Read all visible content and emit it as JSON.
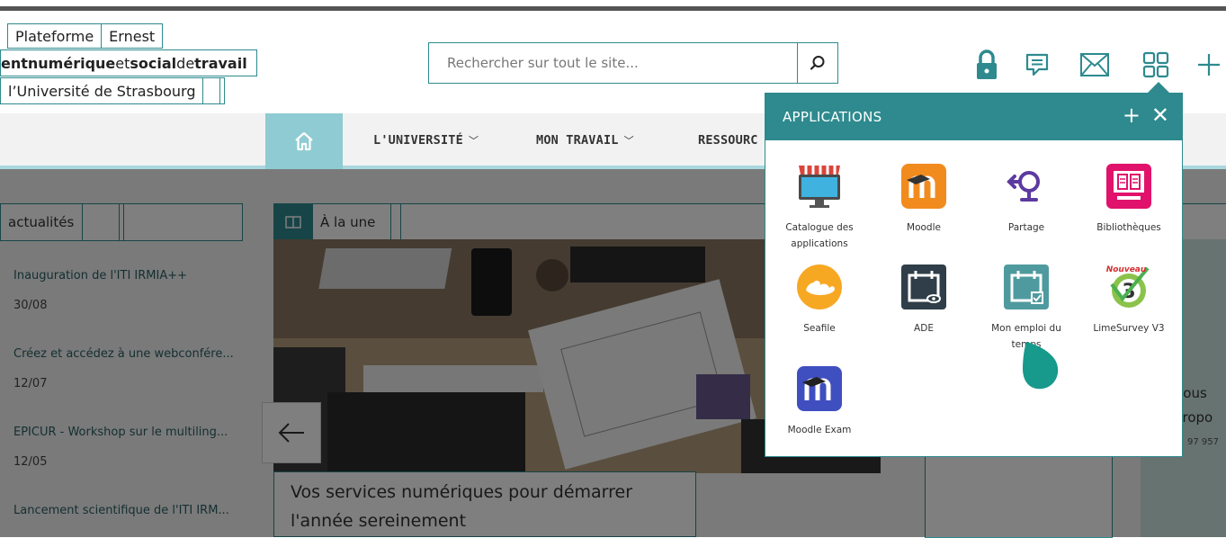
{
  "brand": {
    "platform": "Plateforme",
    "name": "Ernest",
    "tagline_pre": "ent ",
    "tagline_bold1": "numérique",
    "tagline_mid": " et ",
    "tagline_bold2": "social",
    "tagline_mid2": " de ",
    "tagline_bold3": "travail",
    "university": "l’Université de Strasbourg"
  },
  "search": {
    "placeholder": "Rechercher sur tout le site..."
  },
  "header_icons": [
    "lock-icon",
    "chat-icon",
    "mail-icon",
    "apps-grid-icon",
    "plus-icon"
  ],
  "nav": {
    "items": [
      {
        "label": "L'UNIVERSITÉ"
      },
      {
        "label": "MON TRAVAIL"
      },
      {
        "label": "RESSOURC"
      }
    ]
  },
  "news": {
    "header": "actualités",
    "items": [
      {
        "title": "Inauguration de l'ITI IRMIA++",
        "date": "30/08"
      },
      {
        "title": "Créez et accédez à une webconfére...",
        "date": "12/07"
      },
      {
        "title": "EPICUR - Workshop sur le multiling...",
        "date": "12/05"
      },
      {
        "title": "Lancement scientifique de l'ITI IRM...",
        "date": ""
      }
    ]
  },
  "featured": {
    "header": "À la une",
    "caption": "Vos services numériques pour démarrer l'année sereinement"
  },
  "apps_panel": {
    "title": "APPLICATIONS",
    "add_symbol": "+",
    "close_symbol": "✕",
    "items": [
      {
        "label": "Catalogue des applications",
        "icon": "catalogue-icon"
      },
      {
        "label": "Moodle",
        "icon": "moodle-icon"
      },
      {
        "label": "Partage",
        "icon": "partage-icon"
      },
      {
        "label": "Bibliothèques",
        "icon": "bibliotheques-icon"
      },
      {
        "label": "Seafile",
        "icon": "seafile-icon"
      },
      {
        "label": "ADE",
        "icon": "ade-icon"
      },
      {
        "label": "Mon emploi du temps",
        "icon": "calendar-icon"
      },
      {
        "label": "LimeSurvey V3",
        "icon": "limesurvey-icon"
      },
      {
        "label": "Moodle Exam",
        "icon": "moodle-exam-icon"
      }
    ],
    "limesurvey_badge": "Nouveau"
  },
  "right_peek": {
    "line1": "Bous",
    "line2": "propo",
    "line3": "97 957"
  },
  "colors": {
    "teal": "#2e8a8e",
    "light_teal": "#8fcbd2"
  }
}
